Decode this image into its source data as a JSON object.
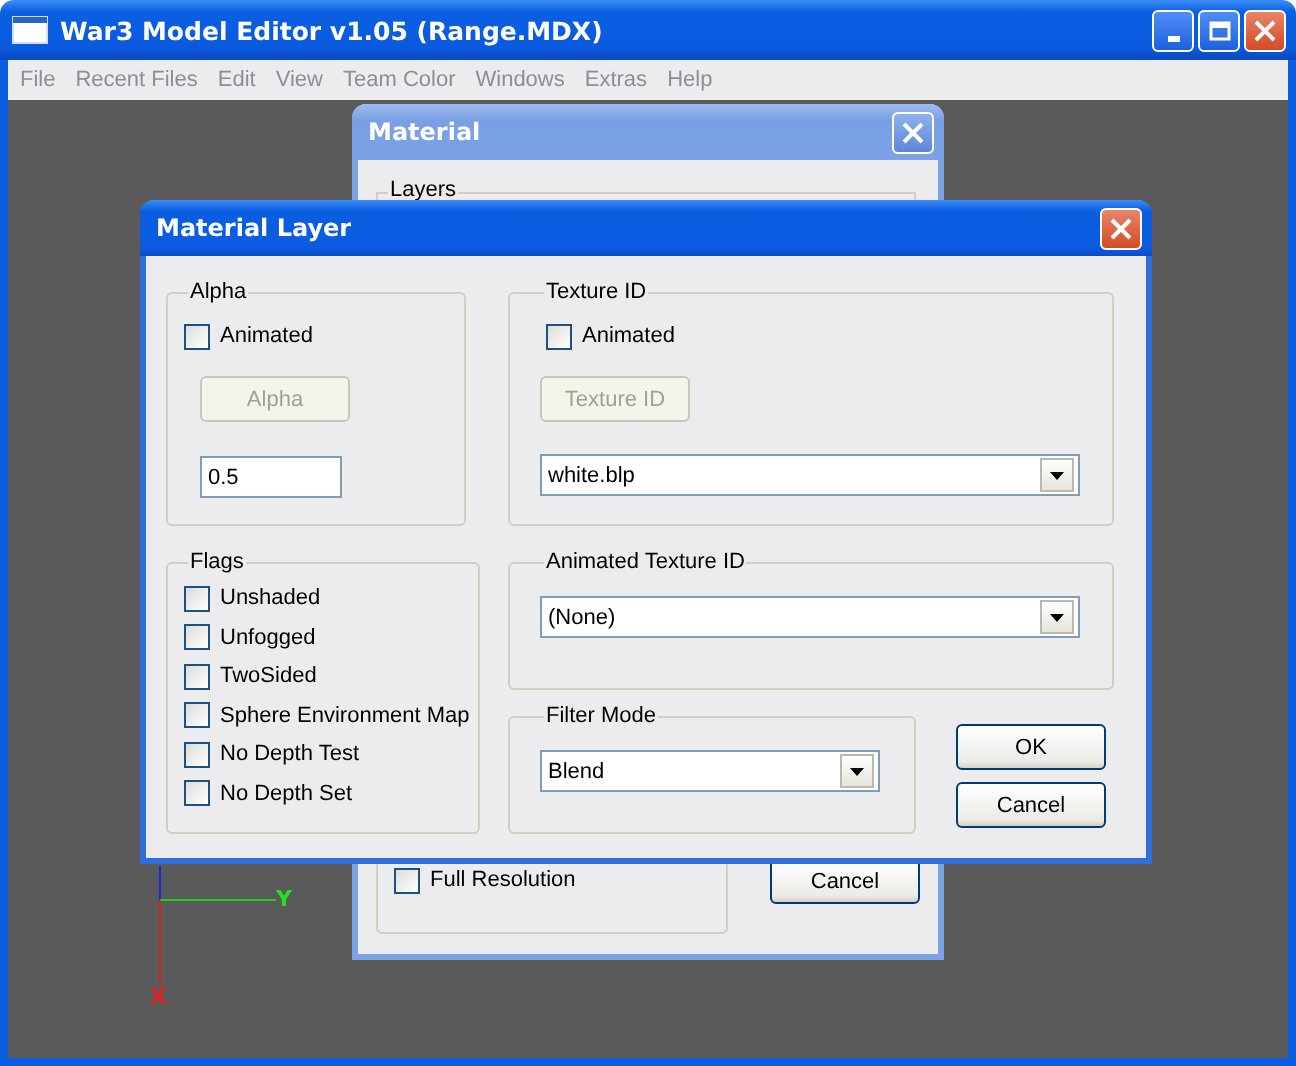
{
  "window": {
    "title": "War3 Model Editor v1.05 (Range.MDX)"
  },
  "menu": [
    {
      "label": "File",
      "disabled": true
    },
    {
      "label": "Recent Files",
      "disabled": true
    },
    {
      "label": "Edit",
      "disabled": true
    },
    {
      "label": "View",
      "disabled": true
    },
    {
      "label": "Team Color",
      "disabled": true
    },
    {
      "label": "Windows",
      "disabled": true
    },
    {
      "label": "Extras",
      "disabled": true
    },
    {
      "label": "Help",
      "disabled": true
    }
  ],
  "viewport": {
    "y_axis_label": "Y",
    "x_axis_label": "X"
  },
  "material_dialog": {
    "title": "Material",
    "layers_label": "Layers",
    "full_resolution": {
      "label": "Full Resolution",
      "checked": false
    },
    "cancel_button": "Cancel"
  },
  "layer_dialog": {
    "title": "Material Layer",
    "alpha": {
      "label": "Alpha",
      "animated": {
        "label": "Animated",
        "checked": false
      },
      "button": {
        "label": "Alpha",
        "disabled": true
      },
      "value": "0.5"
    },
    "flags": {
      "label": "Flags",
      "items": [
        {
          "label": "Unshaded",
          "checked": false
        },
        {
          "label": "Unfogged",
          "checked": false
        },
        {
          "label": "TwoSided",
          "checked": false
        },
        {
          "label": "Sphere Environment Map",
          "checked": false
        },
        {
          "label": "No Depth Test",
          "checked": false
        },
        {
          "label": "No Depth Set",
          "checked": false
        }
      ]
    },
    "texture_id": {
      "label": "Texture ID",
      "animated": {
        "label": "Animated",
        "checked": false
      },
      "button": {
        "label": "Texture ID",
        "disabled": true
      },
      "value": "white.blp"
    },
    "animated_texture_id": {
      "label": "Animated Texture ID",
      "value": "(None)"
    },
    "filter_mode": {
      "label": "Filter Mode",
      "value": "Blend"
    },
    "buttons": [
      "OK",
      "Cancel"
    ]
  }
}
